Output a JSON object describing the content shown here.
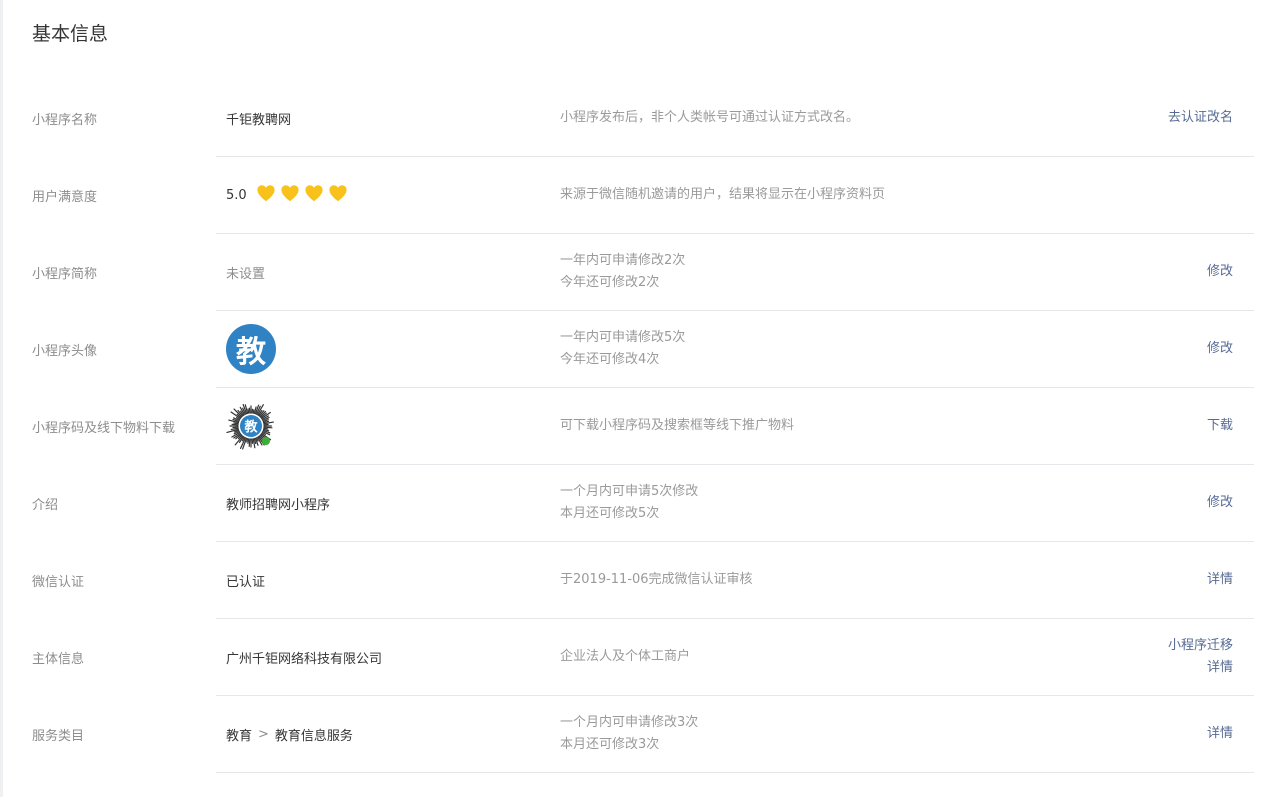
{
  "section": {
    "title": "基本信息"
  },
  "colors": {
    "link": "#576b95",
    "heart": "#f8c21b",
    "avatar": "#2f82c4"
  },
  "icons": {
    "heart": "heart-icon",
    "avatar": "avatar-image",
    "qrcode": "qrcode-image"
  },
  "rows": {
    "name": {
      "label": "小程序名称",
      "value": "千钜教聘网",
      "desc": "小程序发布后，非个人类帐号可通过认证方式改名。",
      "action": "去认证改名"
    },
    "rating": {
      "label": "用户满意度",
      "score": "5.0",
      "hearts": 4,
      "desc": "来源于微信随机邀请的用户，结果将显示在小程序资料页"
    },
    "short_name": {
      "label": "小程序简称",
      "value": "未设置",
      "desc_line1": "一年内可申请修改2次",
      "desc_line2": "今年还可修改2次",
      "action": "修改"
    },
    "avatar": {
      "label": "小程序头像",
      "avatar_char": "教",
      "desc_line1": "一年内可申请修改5次",
      "desc_line2": "今年还可修改4次",
      "action": "修改"
    },
    "qrcode": {
      "label": "小程序码及线下物料下载",
      "qr_char": "教",
      "desc": "可下载小程序码及搜索框等线下推广物料",
      "action": "下载"
    },
    "intro": {
      "label": "介绍",
      "value": "教师招聘网小程序",
      "desc_line1": "一个月内可申请5次修改",
      "desc_line2": "本月还可修改5次",
      "action": "修改"
    },
    "verify": {
      "label": "微信认证",
      "value": "已认证",
      "desc": "于2019-11-06完成微信认证审核",
      "action": "详情"
    },
    "entity": {
      "label": "主体信息",
      "value": "广州千钜网络科技有限公司",
      "desc": "企业法人及个体工商户",
      "action_migrate": "小程序迁移",
      "action_detail": "详情"
    },
    "category": {
      "label": "服务类目",
      "value_parent": "教育",
      "value_sep": ">",
      "value_child": "教育信息服务",
      "desc_line1": "一个月内可申请修改3次",
      "desc_line2": "本月还可修改3次",
      "action": "详情"
    }
  }
}
